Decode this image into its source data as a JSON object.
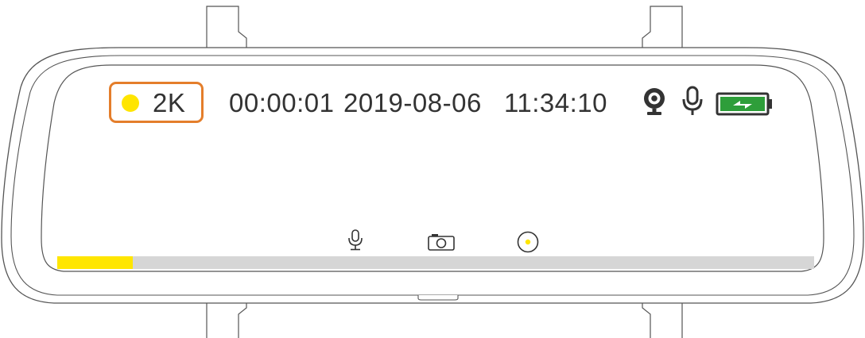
{
  "status_bar": {
    "resolution_label": "2K",
    "elapsed_time": "00:00:01",
    "date": "2019-08-06",
    "time": "11:34:10",
    "icons": [
      "camera-icon",
      "microphone-icon",
      "battery-charging-icon"
    ]
  },
  "bottom_controls": {
    "icons": [
      "microphone-icon",
      "camera-snapshot-icon",
      "record-icon"
    ]
  },
  "recording": {
    "progress": 0.1
  },
  "colors": {
    "highlight_box": "#E47E2B",
    "recording_dot": "#FFE500",
    "progress_fill": "#FFE600",
    "progress_track": "#D6D6D6",
    "battery": "#2E9E3A",
    "text": "#333333",
    "outline": "#555555"
  }
}
